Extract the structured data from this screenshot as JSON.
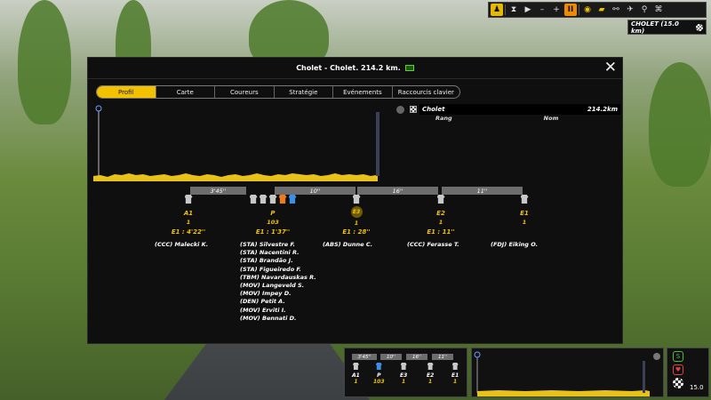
{
  "hud": {
    "location": "CHOLET (15.0 km)",
    "buttons": [
      {
        "icon": "person-icon",
        "glyph": "♟",
        "style": "yellow"
      },
      {
        "icon": "hourglass-icon",
        "glyph": "⧗",
        "style": ""
      },
      {
        "icon": "play-icon",
        "glyph": "▶",
        "style": ""
      },
      {
        "icon": "minus-icon",
        "glyph": "–",
        "style": ""
      },
      {
        "icon": "plus-icon",
        "glyph": "+",
        "style": ""
      },
      {
        "icon": "pause-icon",
        "glyph": "II",
        "style": "orange"
      },
      {
        "icon": "eye-icon",
        "glyph": "◉",
        "style": "eye"
      },
      {
        "icon": "car-icon",
        "glyph": "▰",
        "style": "eye"
      },
      {
        "icon": "motorbike-icon",
        "glyph": "⚯",
        "style": ""
      },
      {
        "icon": "helicopter-icon",
        "glyph": "✈",
        "style": ""
      },
      {
        "icon": "bike-icon",
        "glyph": "⚲",
        "style": ""
      },
      {
        "icon": "broadcast-icon",
        "glyph": "⌘",
        "style": ""
      }
    ]
  },
  "window": {
    "title": "Cholet - Cholet. 214.2 km.",
    "close_glyph": "✕"
  },
  "tabs": [
    {
      "label": "Profil",
      "active": true
    },
    {
      "label": "Carte",
      "active": false
    },
    {
      "label": "Coureurs",
      "active": false
    },
    {
      "label": "Stratégie",
      "active": false
    },
    {
      "label": "Evénements",
      "active": false
    },
    {
      "label": "Raccourcis clavier",
      "active": false
    }
  ],
  "ranking": {
    "finish_name": "Cholet",
    "distance": "214.2km",
    "col_rank": "Rang",
    "col_name": "Nom"
  },
  "gaps": [
    "3'45''",
    "10''",
    "16''",
    "11''"
  ],
  "groups": [
    {
      "label": "A1",
      "count": "1",
      "gap": "E1 : 4'22''",
      "badge": false,
      "jerseys": [
        "#c8c8c8"
      ],
      "riders": [
        "(CCC) Malecki K."
      ]
    },
    {
      "label": "P",
      "count": "103",
      "gap": "E1 : 1'37''",
      "badge": false,
      "jerseys": [
        "#c8c8c8",
        "#c8c8c8",
        "#c8c8c8",
        "#f07a1a",
        "#3a8ee6"
      ],
      "riders": [
        "(STA) Silvestre F.",
        "(STA) Nacentini R.",
        "(STA) Brandão J.",
        "(STA) Figueiredo F.",
        "(TBM) Navardauskas R.",
        "(MOV) Langeveld S.",
        "(MOV) Impey D.",
        "(DEN) Petit A.",
        "(MOV) Erviti I.",
        "(MOV) Bennati D."
      ]
    },
    {
      "label": "E3",
      "count": "1",
      "gap": "E1 : 28''",
      "badge": true,
      "jerseys": [
        "#c8c8c8"
      ],
      "riders": [
        "(ABS) Dunne C."
      ]
    },
    {
      "label": "E2",
      "count": "1",
      "gap": "E1 : 11''",
      "badge": false,
      "jerseys": [
        "#c8c8c8"
      ],
      "riders": [
        "(CCC) Ferasse T."
      ]
    },
    {
      "label": "E1",
      "count": "1",
      "gap": "",
      "badge": false,
      "jerseys": [
        "#c8c8c8"
      ],
      "riders": [
        "(FDJ) Eiking O."
      ]
    }
  ],
  "mini": {
    "gaps": [
      "3'45''",
      "10''",
      "16''",
      "11''"
    ],
    "groups": [
      {
        "label": "A1",
        "count": "1"
      },
      {
        "label": "P",
        "count": "103"
      },
      {
        "label": "E3",
        "count": "1"
      },
      {
        "label": "E2",
        "count": "1"
      },
      {
        "label": "E1",
        "count": "1"
      }
    ],
    "speed": "15.0"
  },
  "colors": {
    "accent": "#f2c200",
    "profile_fill": "#e8c21a",
    "panel_bg": "#0f0f0f",
    "gap_bar": "#6d6d6d"
  }
}
